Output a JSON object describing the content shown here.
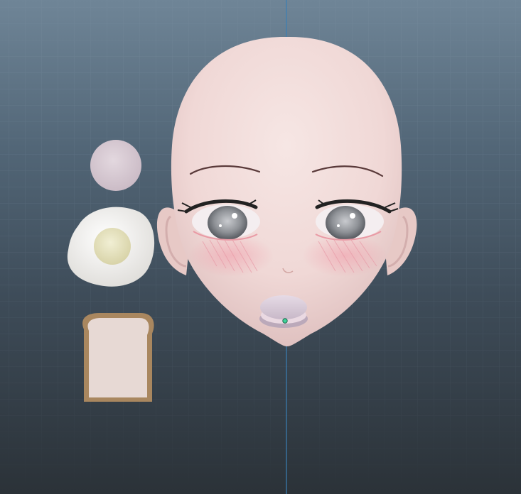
{
  "viewport": {
    "view": "3d-modeling-viewport",
    "background_top": "#6f8597",
    "background_bottom": "#2b3238",
    "grid_color": "#7e93a4",
    "axis_line_color": "#3a7fb5",
    "grid_visible": true
  },
  "objects": [
    {
      "name": "head-model",
      "kind": "3d-mesh",
      "skin_color": "#f3ddd9",
      "eye_color": "#8e9196",
      "brow_color": "#5a3a3a"
    },
    {
      "name": "macaron-mouth-prop",
      "kind": "3d-mesh",
      "color": "#d9cbd8"
    },
    {
      "name": "ball-prop",
      "kind": "3d-mesh",
      "color": "#d8cbd3"
    },
    {
      "name": "fried-egg-prop",
      "kind": "3d-mesh",
      "white_color": "#f5f3ef",
      "yolk_color": "#e9e6c4"
    },
    {
      "name": "toast-slice-prop",
      "kind": "3d-mesh",
      "crust_color": "#a9875f",
      "crumb_color": "#e7d9d4"
    },
    {
      "name": "pivot-gizmo",
      "kind": "selection-marker",
      "color": "#3fd19a"
    }
  ]
}
